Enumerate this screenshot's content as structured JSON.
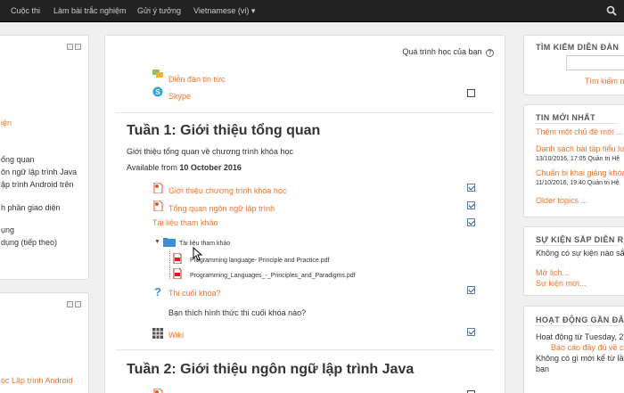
{
  "nav": {
    "items": [
      "Cuộc thi",
      "Làm bài trắc nghiệm",
      "Gửi ý tưởng",
      "Vietnamese (vi) ▾"
    ]
  },
  "left": {
    "orange_link": "iện",
    "items": [
      "ổng quan",
      "ôn ngữ lập trình Java",
      "ập trình Android trên",
      "h phần giao diện",
      "ụng",
      "dụng (tiếp theo)"
    ],
    "bottom_link": "ọc Lập trình Android"
  },
  "main": {
    "progress_label": "Quá trình học của bạn",
    "top_links": [
      "Diễn đàn tin tức",
      "Skype"
    ],
    "week1": {
      "title": "Tuần 1: Giới thiệu tổng quan",
      "summary": "Giới thiệu tổng quan về chương trình khóa học",
      "available_prefix": "Available from",
      "available_date": "10 October 2016",
      "activities": [
        "Giới thiệu chương trình khóa học",
        "Tổng quan ngôn ngữ lập trình",
        "Tài liệu tham khảo"
      ],
      "folder_label": "Tài liệu tham khảo",
      "files": [
        "Programming language- Principle and Practice.pdf",
        "Programming_Languages_-_Principles_and_Paradigms.pdf"
      ],
      "quiz": "Thi cuối khóa?",
      "quiz_desc": "Bạn thích hình thức thi cuối khóa nào?",
      "wiki": "Wiki"
    },
    "week2": {
      "title": "Tuần 2: Giới thiệu ngôn ngữ lập trình Java"
    }
  },
  "right": {
    "search": {
      "header": "TÌM KIẾM DIỄN ĐÀN",
      "advanced": "Tìm kiếm n"
    },
    "news": {
      "header": "TIN MỚI NHẤT",
      "add_topic": "Thêm một chủ đề mới ...",
      "posts": [
        {
          "title": "Danh sách bài tập tiểu luận",
          "meta": "13/10/2016, 17:05 Quản trị Hệ"
        },
        {
          "title": "Chuẩn bị khai giảng khóa lớ",
          "meta": "11/10/2016, 19:40 Quản trị Hệ"
        }
      ],
      "older": "Older topics ..."
    },
    "events": {
      "header": "SỰ KIỆN SẮP DIỄN RA",
      "none": "Không có sự kiện nào sắp",
      "calendar": "Mở lịch...",
      "new_event": "Sự kiện mới..."
    },
    "activity": {
      "header": "HOẠT ĐỘNG GẦN ĐÂY",
      "since": "Hoạt động từ Tuesday, 27 l",
      "full_report": "Báo cáo đầy đủ về các",
      "nothing": "Không có gì mới kể từ lần c",
      "nothing2": "bạn"
    }
  }
}
